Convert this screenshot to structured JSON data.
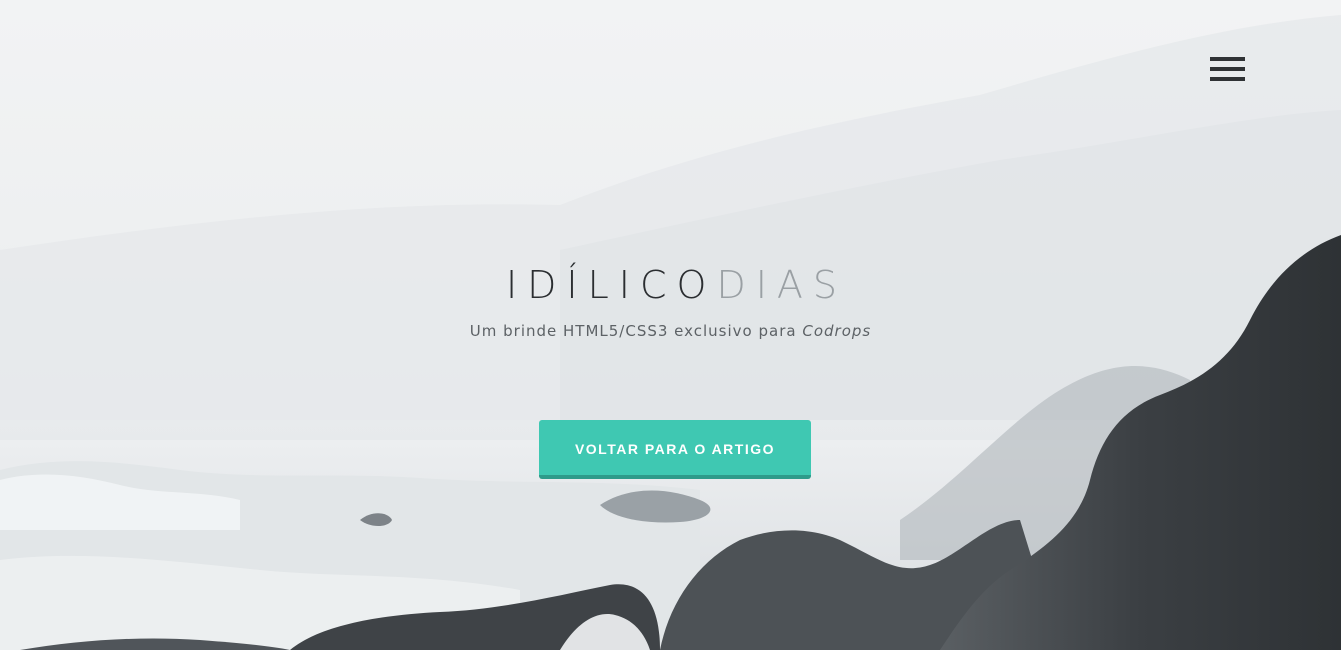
{
  "menu": {
    "icon": "hamburger-menu-icon"
  },
  "hero": {
    "title_dark": "IDÍLICO",
    "title_light": "DIAS",
    "subtitle_text": "Um brinde HTML5/CSS3 exclusivo para",
    "subtitle_emphasis": "Codrops",
    "cta_label": "VOLTAR PARA O ARTIGO"
  },
  "colors": {
    "accent": "#3fc8b2",
    "accent_shadow": "#2e9b8a",
    "title_dark": "#2b2e31",
    "title_light": "#9aa0a4"
  }
}
